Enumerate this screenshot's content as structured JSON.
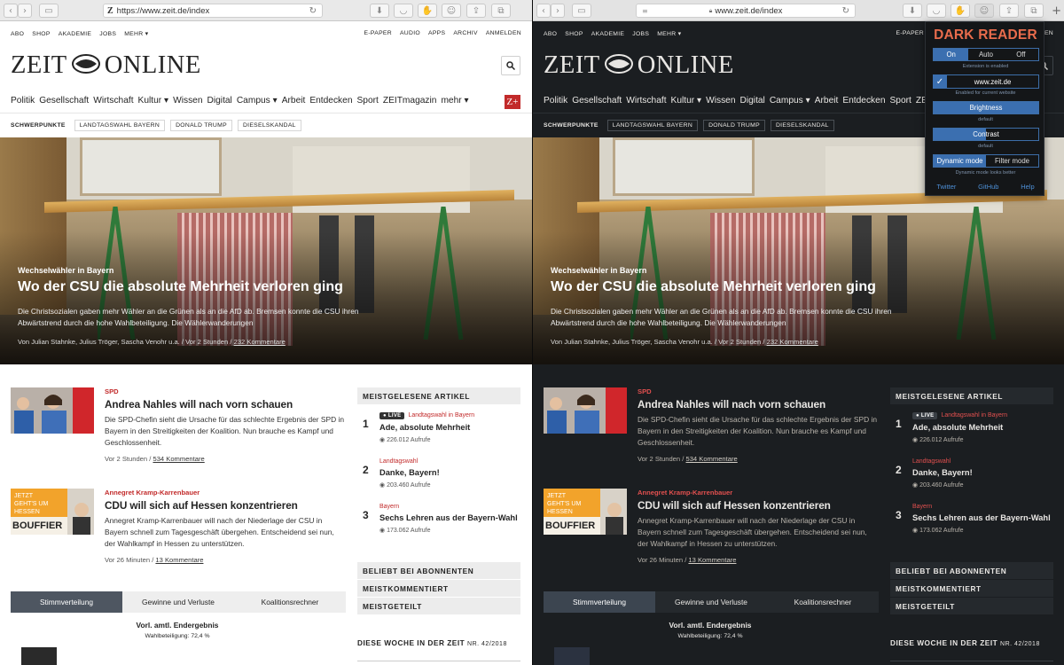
{
  "left": {
    "url": "https://www.zeit.de/index",
    "top_nav_left": [
      "ABO",
      "SHOP",
      "AKADEMIE",
      "JOBS",
      "MEHR ▾"
    ],
    "top_nav_right": [
      "E-PAPER",
      "AUDIO",
      "APPS",
      "ARCHIV",
      "ANMELDEN"
    ],
    "logo_left": "ZEIT",
    "logo_right": "ONLINE",
    "main_nav": [
      "Politik",
      "Gesellschaft",
      "Wirtschaft",
      "Kultur ▾",
      "Wissen",
      "Digital",
      "Campus ▾",
      "Arbeit",
      "Entdecken",
      "Sport",
      "ZEITmagazin",
      "mehr ▾"
    ],
    "zplus": "Z+"
  },
  "right": {
    "url": "www.zeit.de/index"
  },
  "schwerpunkte": {
    "label": "SCHWERPUNKTE",
    "tags": [
      "LANDTAGSWAHL BAYERN",
      "DONALD TRUMP",
      "DIESELSKANDAL"
    ]
  },
  "hero": {
    "kicker": "Wechselwähler in Bayern",
    "headline": "Wo der CSU die absolute Mehrheit verloren ging",
    "teaser": "Die Christsozialen gaben mehr Wähler an die Grünen als an die AfD ab. Bremsen konnte die CSU ihren Abwärtstrend durch die hohe Wahlbeteiligung. Die Wählerwanderungen",
    "meta_prefix": "Von Julian Stahnke, Julius Tröger, Sascha Venohr u.a.  /  Vor 2 Stunden  /  ",
    "comments": "232 Kommentare"
  },
  "articles": [
    {
      "kicker": "SPD",
      "title": "Andrea Nahles will nach vorn schauen",
      "teaser": "Die SPD-Chefin sieht die Ursache für das schlechte Ergebnis der SPD in Bayern in den Streitigkeiten der Koalition. Nun brauche es Kampf und Geschlossenheit.",
      "meta_prefix": "Vor 2 Stunden  /  ",
      "comments": "534 Kommentare"
    },
    {
      "kicker": "Annegret Kramp-Karrenbauer",
      "title": "CDU will sich auf Hessen konzentrieren",
      "teaser": "Annegret Kramp-Karrenbauer will nach der Niederlage der CSU in Bayern schnell zum Tagesgeschäft übergehen. Entscheidend sei nun, der Wahlkampf in Hessen zu unterstützen.",
      "meta_prefix": "Vor 26 Minuten  /  ",
      "comments": "13 Kommentare",
      "image_text": [
        "JETZT",
        "GEHT'S UM",
        "HESSEN",
        "BOUFFIER"
      ]
    }
  ],
  "sidebar": {
    "header": "MEISTGELESENE ARTIKEL",
    "items": [
      {
        "num": "1",
        "live": "LIVE",
        "kicker": "Landtagswahl in Bayern",
        "title": "Ade, absolute Mehrheit",
        "views": "226.012 Aufrufe"
      },
      {
        "num": "2",
        "kicker": "Landtagswahl",
        "title": "Danke, Bayern!",
        "views": "203.460 Aufrufe"
      },
      {
        "num": "3",
        "kicker": "Bayern",
        "title": "Sechs Lehren aus der Bayern-Wahl",
        "views": "173.062 Aufrufe"
      }
    ],
    "more": [
      "BELIEBT BEI ABONNENTEN",
      "MEISTKOMMENTIERT",
      "MEISTGETEILT"
    ]
  },
  "tabs": [
    "Stimmverteilung",
    "Gewinne und Verluste",
    "Koalitionsrechner"
  ],
  "ergebnis": {
    "title": "Vorl. amtl. Endergebnis",
    "sub": "Wahlbeteiligung: 72,4 %"
  },
  "diese_woche": {
    "label": "DIESE WOCHE IN DER ZEIT",
    "issue": "NR. 42/2018"
  },
  "dark_reader": {
    "title": "DARK READER",
    "modes": [
      "On",
      "Auto",
      "Off"
    ],
    "extension_note": "Extension is enabled",
    "site": "www.zeit.de",
    "site_note": "Enabled for current website",
    "brightness_label": "Brightness",
    "brightness_note": "default",
    "contrast_label": "Contrast",
    "contrast_note": "default",
    "engine": [
      "Dynamic mode",
      "Filter mode"
    ],
    "engine_note": "Dynamic mode looks better",
    "links": [
      "Twitter",
      "GitHub",
      "Help"
    ],
    "accent": "#3b6fb0",
    "brand_color": "#e96c4c"
  }
}
